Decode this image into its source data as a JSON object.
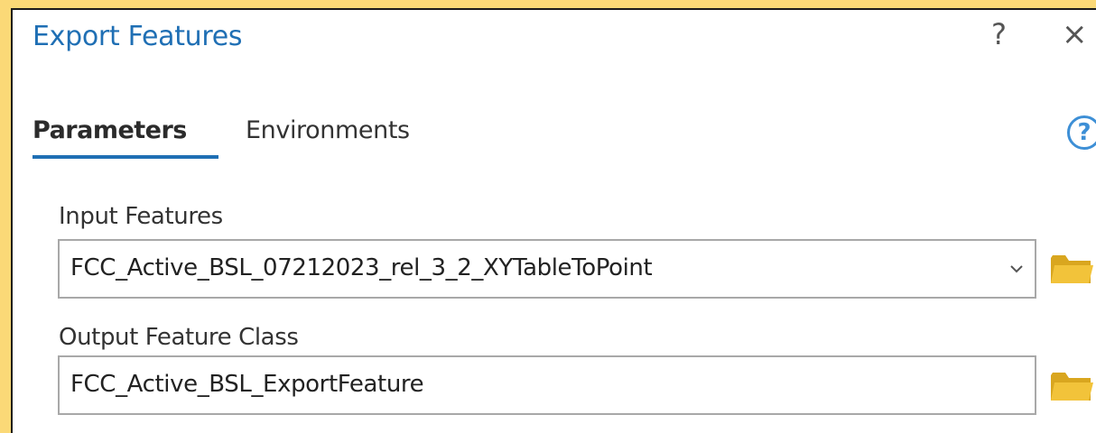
{
  "dialog": {
    "title": "Export Features",
    "help_glyph": "?",
    "close_glyph": "×"
  },
  "tabs": [
    {
      "label": "Parameters",
      "active": true
    },
    {
      "label": "Environments",
      "active": false
    }
  ],
  "tool_help_icon": "help-circle-icon",
  "tool_help_glyph": "?",
  "parameters": {
    "input_features": {
      "label": "Input Features",
      "value": "FCC_Active_BSL_07212023_rel_3_2_XYTableToPoint",
      "has_dropdown": true,
      "browse_icon": "folder-icon"
    },
    "output_feature_class": {
      "label": "Output Feature Class",
      "value": "FCC_Active_BSL_ExportFeature",
      "browse_icon": "folder-icon"
    }
  },
  "colors": {
    "accent": "#1f6fb4",
    "frame_background": "#fbd977",
    "folder": "#f2c33a"
  }
}
